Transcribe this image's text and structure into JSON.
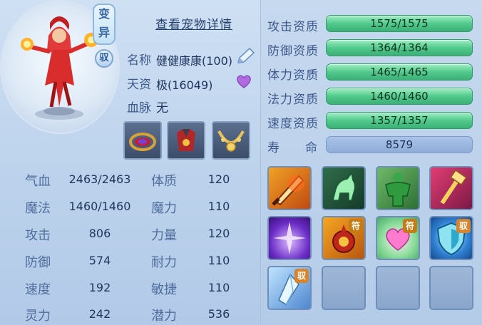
{
  "header": {
    "variant_tag": "变\n异",
    "variant_line1": "变",
    "variant_line2": "异",
    "tame_tag": "驭",
    "detail_link": "查看宠物详情"
  },
  "info": {
    "name_label": "名称",
    "name_value": "健健康康(100)",
    "talent_label": "天资",
    "talent_value": "极(16049)",
    "bloodline_label": "血脉",
    "bloodline_value": "无"
  },
  "equipment": [
    "red-gold-ring-item",
    "red-armor-item",
    "gold-necklace-item"
  ],
  "stats": {
    "hp_label": "气血",
    "hp_value": "2463/2463",
    "mp_label": "魔法",
    "mp_value": "1460/1460",
    "atk_label": "攻击",
    "atk_value": "806",
    "def_label": "防御",
    "def_value": "574",
    "spd_label": "速度",
    "spd_value": "192",
    "spirit_label": "灵力",
    "spirit_value": "242",
    "con_label": "体质",
    "con_value": "120",
    "mag_label": "魔力",
    "mag_value": "110",
    "str_label": "力量",
    "str_value": "120",
    "end_label": "耐力",
    "end_value": "110",
    "agi_label": "敏捷",
    "agi_value": "110",
    "pot_label": "潜力",
    "pot_value": "536"
  },
  "aptitudes": [
    {
      "label": "攻击资质",
      "value": "1575/1575"
    },
    {
      "label": "防御资质",
      "value": "1364/1364"
    },
    {
      "label": "体力资质",
      "value": "1465/1465"
    },
    {
      "label": "法力资质",
      "value": "1460/1460"
    },
    {
      "label": "速度资质",
      "value": "1357/1357"
    }
  ],
  "lifespan": {
    "label1": "寿",
    "label2": "命",
    "value": "8579"
  },
  "skills": {
    "badge_fu": "符",
    "badge_yu": "驭"
  },
  "colors": {
    "aptitude_bar": "#52c98d",
    "life_bar": "#8fadd9",
    "panel_bg": "#c7d9ef"
  }
}
